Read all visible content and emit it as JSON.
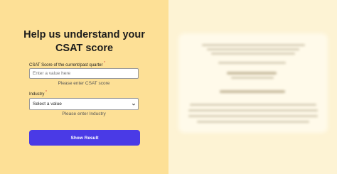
{
  "form": {
    "title_line1": "Help us understand your",
    "title_line2": "CSAT score",
    "csat": {
      "label": "CSAT Score of the current/past quarter",
      "required_mark": "*",
      "placeholder": "Enter a value here",
      "hint": "Please enter CSAT score"
    },
    "industry": {
      "label": "Industry",
      "required_mark": "*",
      "selected": "Select a value",
      "hint": "Please enter Industry"
    },
    "submit_label": "Show Result"
  },
  "colors": {
    "left_panel": "#fde096",
    "right_panel": "#fdf3d4",
    "button": "#4a3ae6"
  },
  "icons": {
    "select_chevron": "chevron-down-icon"
  }
}
